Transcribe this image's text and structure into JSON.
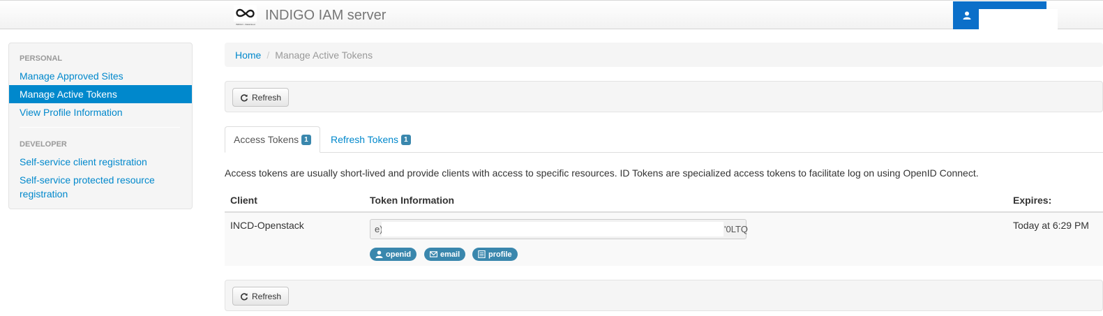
{
  "app": {
    "title": "INDIGO IAM server",
    "logo_caption": "INDIGO - DataCloud",
    "accent_color": "#0088cc",
    "user_button_color": "#0b6fc9"
  },
  "sidebar": {
    "personal_header": "PERSONAL",
    "personal_items": [
      {
        "label": "Manage Approved Sites",
        "active": false
      },
      {
        "label": "Manage Active Tokens",
        "active": true
      },
      {
        "label": "View Profile Information",
        "active": false
      }
    ],
    "developer_header": "DEVELOPER",
    "developer_items": [
      {
        "label": "Self-service client registration"
      },
      {
        "label": "Self-service protected resource registration"
      }
    ],
    "developer_item2_line1": "Self-service protected resource",
    "developer_item2_line2": "registration"
  },
  "breadcrumb": {
    "home": "Home",
    "separator": "/",
    "current": "Manage Active Tokens"
  },
  "toolbar": {
    "refresh_label": "Refresh",
    "refresh_icon": "refresh-icon"
  },
  "tabs": [
    {
      "label": "Access Tokens",
      "count": "1",
      "active": true
    },
    {
      "label": "Refresh Tokens",
      "count": "1",
      "active": false
    }
  ],
  "description": "Access tokens are usually short-lived and provide clients with access to specific resources. ID Tokens are specialized access tokens to facilitate log on using OpenID Connect.",
  "table": {
    "headers": {
      "client": "Client",
      "token": "Token Information",
      "expires": "Expires:"
    },
    "rows": [
      {
        "client": "INCD-Openstack",
        "token_start": "e)",
        "token_end": "'0LTQ",
        "expires": "Today at 6:29 PM",
        "scopes": [
          {
            "label": "openid",
            "icon": "user-icon"
          },
          {
            "label": "email",
            "icon": "envelope-icon"
          },
          {
            "label": "profile",
            "icon": "list-icon"
          }
        ]
      }
    ]
  }
}
